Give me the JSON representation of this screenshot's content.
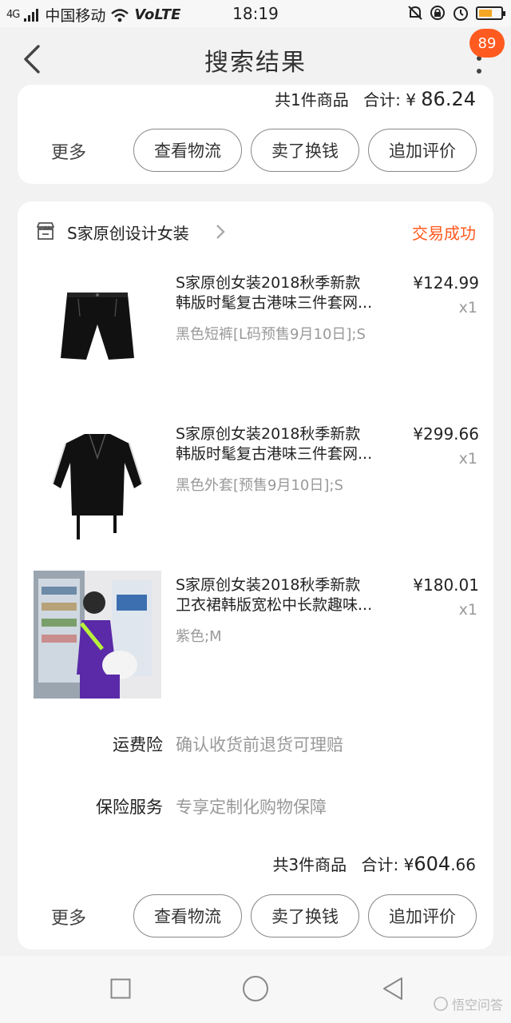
{
  "status_bar": {
    "network": "4G",
    "carrier": "中国移动",
    "volte": "VoLTE",
    "time": "18:19",
    "battery_level": 0.62
  },
  "nav": {
    "title": "搜索结果",
    "badge_count": "89"
  },
  "first_order": {
    "summary": "共1件商品",
    "total_label": "合计:",
    "currency": "¥",
    "total": "86.24",
    "more_label": "更多",
    "buttons": [
      "查看物流",
      "卖了换钱",
      "追加评价"
    ]
  },
  "second_order": {
    "shop_name": "S家原创设计女装",
    "status": "交易成功",
    "items": [
      {
        "title_line1": "S家原创女装2018秋季新款",
        "title_line2": "韩版时髦复古港味三件套网...",
        "sku": "黑色短裤[L码预售9月10日];S",
        "price": "¥124.99",
        "qty": "x1",
        "image": "black-shorts"
      },
      {
        "title_line1": "S家原创女装2018秋季新款",
        "title_line2": "韩版时髦复古港味三件套网...",
        "sku": "黑色外套[预售9月10日];S",
        "price": "¥299.66",
        "qty": "x1",
        "image": "black-blazer"
      },
      {
        "title_line1": "S家原创女装2018秋季新款",
        "title_line2": "卫衣裙韩版宽松中长款趣味...",
        "sku": "紫色;M",
        "price": "¥180.01",
        "qty": "x1",
        "image": "purple-hoodie-model"
      }
    ],
    "services": [
      {
        "label": "运费险",
        "value": "确认收货前退货可理赔"
      },
      {
        "label": "保险服务",
        "value": "专享定制化购物保障"
      }
    ],
    "summary": "共3件商品",
    "total_label": "合计:",
    "currency": "¥",
    "total_int": "604",
    "total_dec": ".66",
    "more_label": "更多",
    "buttons": [
      "查看物流",
      "卖了换钱",
      "追加评价"
    ]
  },
  "system_nav": {
    "icons": [
      "square-icon",
      "circle-icon",
      "triangle-back-icon"
    ]
  },
  "watermark": "悟空问答",
  "colors": {
    "accent": "#ff5a1f",
    "muted_text": "#999999",
    "card_bg": "#ffffff",
    "page_bg": "#f2f2f2"
  }
}
